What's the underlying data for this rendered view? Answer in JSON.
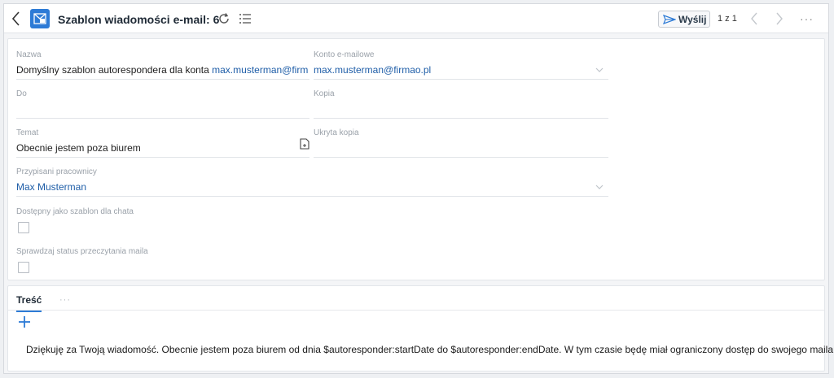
{
  "header": {
    "title": "Szablon wiadomości e-mail: 6",
    "send_label": "Wyślij",
    "pager": "1 z 1",
    "more": "···"
  },
  "form": {
    "name": {
      "label": "Nazwa",
      "value_prefix": "Domyślny szablon autorespondera dla konta ",
      "value_link": "max.musterman@firm"
    },
    "account": {
      "label": "Konto e-mailowe",
      "value": "max.musterman@firmao.pl"
    },
    "to": {
      "label": "Do",
      "value": ""
    },
    "cc": {
      "label": "Kopia",
      "value": ""
    },
    "subject": {
      "label": "Temat",
      "value": "Obecnie jestem poza biurem"
    },
    "bcc": {
      "label": "Ukryta kopia",
      "value": ""
    },
    "assigned": {
      "label": "Przypisani pracownicy",
      "value": "Max Musterman"
    },
    "chat_template": {
      "label": "Dostępny jako szablon dla chata",
      "checked": false
    },
    "read_status": {
      "label": "Sprawdzaj status przeczytania maila",
      "checked": false
    }
  },
  "content": {
    "tab_label": "Treść",
    "tab_more": "···",
    "body": "Dziękuję za Twoją wiadomość. Obecnie jestem poza biurem od dnia $autoresponder:startDate do $autoresponder:endDate. W tym czasie będę miał ograniczony dostęp do swojego maila."
  },
  "colors": {
    "accent": "#2d7bd6",
    "link": "#1f5ea8"
  },
  "icons": [
    "back-icon",
    "email-template-icon",
    "refresh-icon",
    "list-icon",
    "send-icon",
    "chevron-left-icon",
    "chevron-right-icon",
    "chevron-down-icon",
    "attach-icon",
    "plus-icon"
  ]
}
